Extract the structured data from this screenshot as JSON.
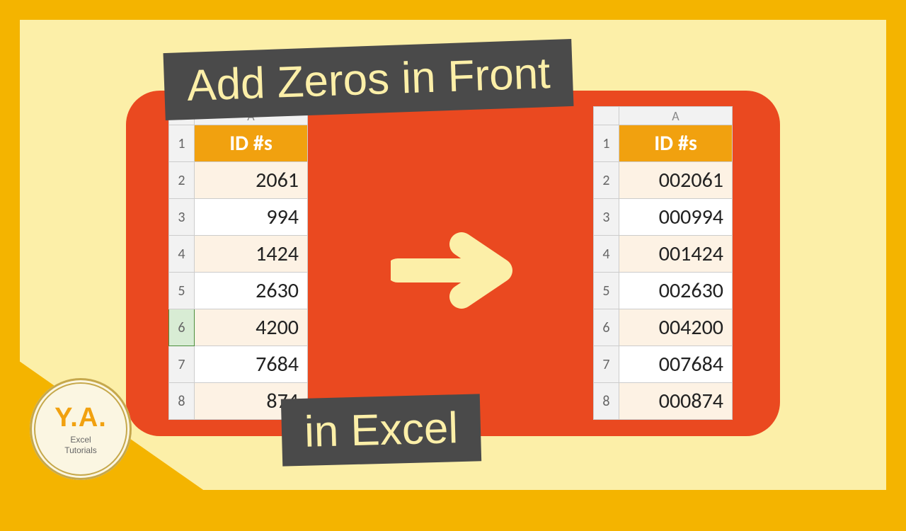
{
  "banner": {
    "top": "Add Zeros in Front",
    "bottom": "in Excel"
  },
  "left_table": {
    "col_header": "A",
    "header_cell": "ID #s",
    "rows": [
      {
        "num": "2",
        "value": "2061"
      },
      {
        "num": "3",
        "value": "994"
      },
      {
        "num": "4",
        "value": "1424"
      },
      {
        "num": "5",
        "value": "2630"
      },
      {
        "num": "6",
        "value": "4200",
        "selected": true
      },
      {
        "num": "7",
        "value": "7684"
      },
      {
        "num": "8",
        "value": "874"
      }
    ]
  },
  "right_table": {
    "col_header": "A",
    "header_cell": "ID #s",
    "rows": [
      {
        "num": "2",
        "value": "002061"
      },
      {
        "num": "3",
        "value": "000994"
      },
      {
        "num": "4",
        "value": "001424"
      },
      {
        "num": "5",
        "value": "002630"
      },
      {
        "num": "6",
        "value": "004200"
      },
      {
        "num": "7",
        "value": "007684"
      },
      {
        "num": "8",
        "value": "000874"
      }
    ]
  },
  "logo": {
    "initials": "Y.A.",
    "line1": "Excel",
    "line2": "Tutorials"
  }
}
